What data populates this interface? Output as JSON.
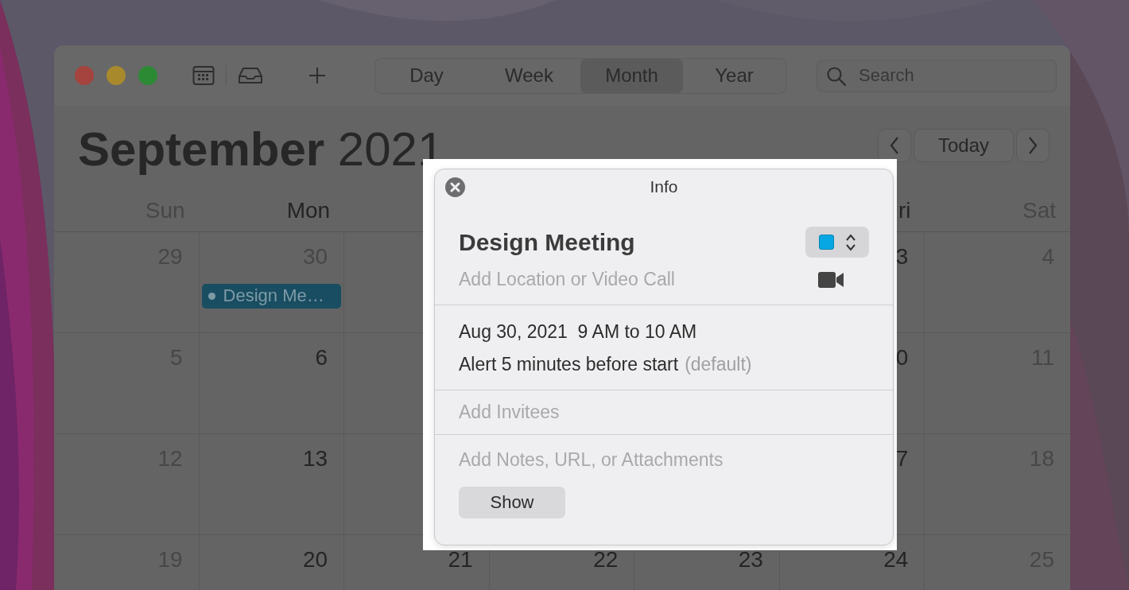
{
  "toolbar": {
    "view_tabs": [
      {
        "label": "Day",
        "selected": false
      },
      {
        "label": "Week",
        "selected": false
      },
      {
        "label": "Month",
        "selected": true
      },
      {
        "label": "Year",
        "selected": false
      }
    ],
    "search": {
      "placeholder": "Search"
    }
  },
  "header": {
    "month": "September",
    "year": "2021",
    "today_button": "Today"
  },
  "month": {
    "weekdays": {
      "sun": {
        "label": "Sun",
        "dimmed": true
      },
      "mon": {
        "label": "Mon",
        "dimmed": false
      },
      "fri": {
        "label": "ri",
        "dimmed": false
      },
      "sat": {
        "label": "Sat",
        "dimmed": true
      }
    },
    "weeks": [
      {
        "cells": [
          {
            "day": "29",
            "dimmed": true
          },
          {
            "day": "30",
            "dimmed": true,
            "events": [
              {
                "title": "Design Me…"
              }
            ]
          },
          {},
          {},
          {},
          {
            "day": "3",
            "dimmed": false
          },
          {
            "day": "4",
            "dimmed": true
          }
        ]
      },
      {
        "cells": [
          {
            "day": "5",
            "dimmed": true
          },
          {
            "day": "6",
            "dimmed": false
          },
          {},
          {},
          {},
          {
            "day": "0",
            "dimmed": false
          },
          {
            "day": "11",
            "dimmed": true
          }
        ]
      },
      {
        "cells": [
          {
            "day": "12",
            "dimmed": true
          },
          {
            "day": "13",
            "dimmed": false
          },
          {},
          {},
          {},
          {
            "day": "7",
            "dimmed": false
          },
          {
            "day": "18",
            "dimmed": true
          }
        ]
      },
      {
        "cells": [
          {
            "day": "19",
            "dimmed": true
          },
          {
            "day": "20",
            "dimmed": false
          },
          {
            "day": "21",
            "dimmed": false
          },
          {
            "day": "22",
            "dimmed": false
          },
          {
            "day": "23",
            "dimmed": false
          },
          {
            "day": "24",
            "dimmed": false
          },
          {
            "day": "25",
            "dimmed": true
          }
        ]
      }
    ]
  },
  "info_popover": {
    "header": "Info",
    "title": "Design Meeting",
    "location_placeholder": "Add Location or Video Call",
    "date_time": "Aug 30, 2021  9 AM to 10 AM",
    "alert": "Alert 5 minutes before start",
    "alert_note": "(default)",
    "invitees_placeholder": "Add Invitees",
    "notes_placeholder": "Add Notes, URL, or Attachments",
    "show_button": "Show"
  }
}
